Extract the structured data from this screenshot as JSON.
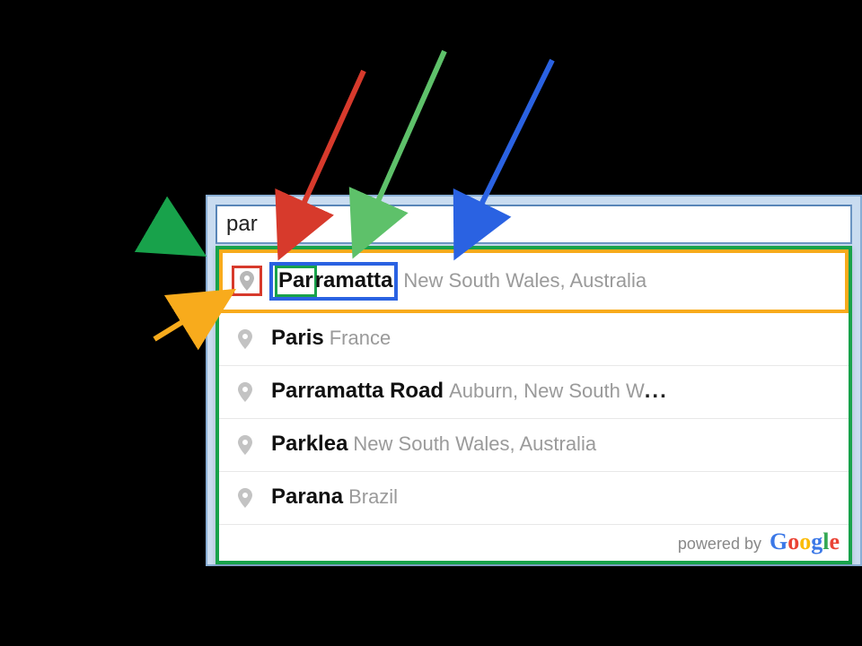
{
  "search": {
    "value": "par"
  },
  "dropdown": {
    "items": [
      {
        "match": "Par",
        "rest": "ramatta",
        "secondary": "New South Wales, Australia"
      },
      {
        "match": "Par",
        "rest": "is",
        "secondary": "France"
      },
      {
        "match": "Par",
        "rest": "ramatta Road",
        "secondary": "Auburn, New South W",
        "truncated": true
      },
      {
        "match": "Par",
        "rest": "klea",
        "secondary": "New South Wales, Australia"
      },
      {
        "match": "Par",
        "rest": "ana",
        "secondary": "Brazil"
      }
    ]
  },
  "powered_label": "powered by",
  "brand": {
    "g": "G",
    "o1": "o",
    "o2": "o",
    "g2": "g",
    "l": "l",
    "e": "e"
  },
  "ellipsis": "..."
}
